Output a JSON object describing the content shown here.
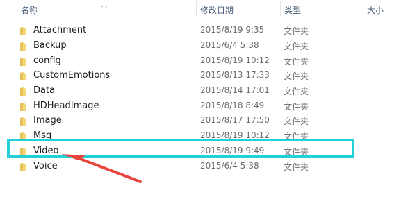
{
  "header": {
    "col_name": "名称",
    "col_date": "修改日期",
    "col_type": "类型",
    "col_size": "大小"
  },
  "files": [
    {
      "name": "Attachment",
      "date": "2015/8/19 9:35",
      "type": "文件夹"
    },
    {
      "name": "Backup",
      "date": "2015/6/4 5:38",
      "type": "文件夹"
    },
    {
      "name": "config",
      "date": "2015/8/19 10:12",
      "type": "文件夹"
    },
    {
      "name": "CustomEmotions",
      "date": "2015/8/13 17:33",
      "type": "文件夹"
    },
    {
      "name": "Data",
      "date": "2015/8/14 17:01",
      "type": "文件夹"
    },
    {
      "name": "HDHeadImage",
      "date": "2015/8/18 8:49",
      "type": "文件夹"
    },
    {
      "name": "Image",
      "date": "2015/8/17 17:50",
      "type": "文件夹"
    },
    {
      "name": "Msg",
      "date": "2015/8/19 10:12",
      "type": "文件夹"
    },
    {
      "name": "Video",
      "date": "2015/8/19 9:49",
      "type": "文件夹"
    },
    {
      "name": "Voice",
      "date": "2015/6/4 5:38",
      "type": "文件夹"
    }
  ],
  "highlighted_file": "Video",
  "colors": {
    "highlight_border": "#24d0d8",
    "arrow": "#e8453c",
    "folder": "#e7c25a"
  },
  "icons": {
    "folder": "folder-icon",
    "sort": "sort-up-icon"
  }
}
